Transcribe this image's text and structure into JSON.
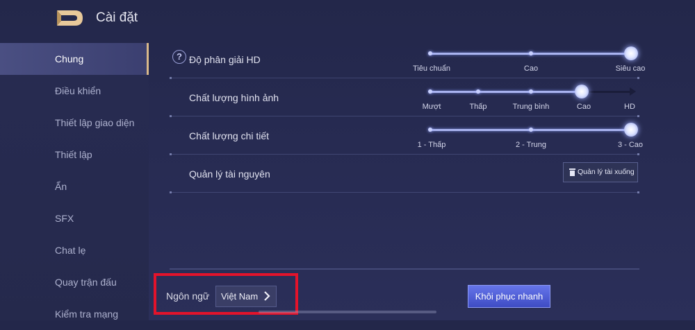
{
  "header": {
    "title": "Cài đặt",
    "back_icon": "back-arrow-icon"
  },
  "sidebar": {
    "items": [
      {
        "label": "Chung",
        "active": true
      },
      {
        "label": "Điều khiển",
        "active": false
      },
      {
        "label": "Thiết lập giao diện",
        "active": false
      },
      {
        "label": "Thiết lập",
        "active": false
      },
      {
        "label": "Ẩn",
        "active": false
      },
      {
        "label": "SFX",
        "active": false
      },
      {
        "label": "Chat lẹ",
        "active": false
      },
      {
        "label": "Quay trận đấu",
        "active": false
      },
      {
        "label": "Kiểm tra mạng",
        "active": false
      }
    ]
  },
  "settings": {
    "resolution": {
      "label": "Độ phân giải HD",
      "options": [
        "Tiêu chuẩn",
        "Cao",
        "Siêu cao"
      ],
      "selected": "Siêu cao"
    },
    "image_quality": {
      "label": "Chất lượng hình ảnh",
      "options": [
        "Mượt",
        "Thấp",
        "Trung bình",
        "Cao",
        "HD"
      ],
      "selected": "Cao"
    },
    "detail_quality": {
      "label": "Chất lượng chi tiết",
      "options": [
        "1 - Thấp",
        "2 - Trung",
        "3 - Cao"
      ],
      "selected": "3 - Cao"
    },
    "resource_mgmt": {
      "label": "Quản lý tài nguyên",
      "button_label": "Quản lý tài xuống"
    }
  },
  "footer": {
    "language_label": "Ngôn ngữ",
    "language_value": "Việt Nam",
    "quick_restore_label": "Khôi phục nhanh"
  },
  "colors": {
    "highlight_box": "#e3132b",
    "accent": "#d9b98a",
    "slider": "#a9b3f0"
  }
}
